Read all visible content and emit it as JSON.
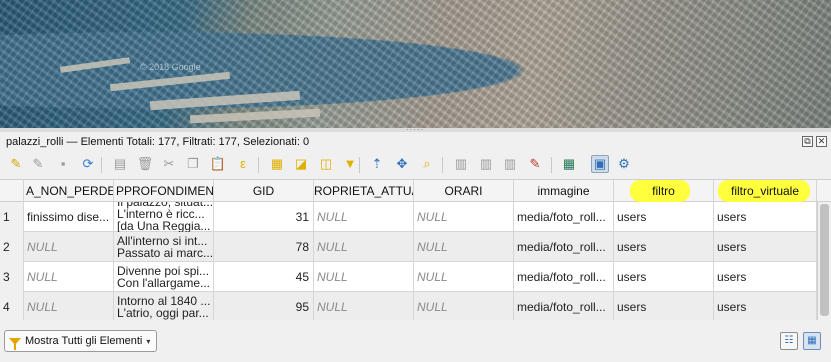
{
  "window": {
    "title": "palazzi_rolli — Elementi Totali: 177, Filtrati: 177, Selezionati: 0",
    "restore_glyph": "⧉",
    "close_glyph": "✕"
  },
  "map": {
    "watermark": "© 2018 Google"
  },
  "toolbar": {
    "buttons": [
      {
        "name": "toggle-editing-icon",
        "glyph": "✎",
        "color": "#d8a400"
      },
      {
        "name": "toggle-multi-edit-icon",
        "glyph": "✎",
        "color": "#9a9a9a"
      },
      {
        "name": "save-edits-icon",
        "glyph": "▪",
        "color": "#9a9a9a"
      },
      {
        "name": "reload-table-icon",
        "glyph": "⟳",
        "color": "#2d7fd0"
      },
      {
        "name": "add-feature-icon",
        "glyph": "▤",
        "color": "#9a9a9a"
      },
      {
        "name": "delete-features-icon",
        "glyph": "🗑",
        "color": "#9a9a9a"
      },
      {
        "name": "cut-features-icon",
        "glyph": "✂",
        "color": "#9a9a9a"
      },
      {
        "name": "copy-features-icon",
        "glyph": "❐",
        "color": "#9a9a9a"
      },
      {
        "name": "paste-features-icon",
        "glyph": "📋",
        "color": "#9a9a9a"
      },
      {
        "name": "select-by-expression-icon",
        "glyph": "ε",
        "color": "#e0b000"
      },
      {
        "name": "select-all-icon",
        "glyph": "▦",
        "color": "#e0b000"
      },
      {
        "name": "invert-selection-icon",
        "glyph": "◪",
        "color": "#e0b000"
      },
      {
        "name": "deselect-all-icon",
        "glyph": "◫",
        "color": "#e0b000"
      },
      {
        "name": "filter-select-icon",
        "glyph": "▼",
        "color": "#e0b000"
      },
      {
        "name": "move-selection-top-icon",
        "glyph": "⇡",
        "color": "#2d6fb8"
      },
      {
        "name": "pan-to-selection-icon",
        "glyph": "✥",
        "color": "#2d6fb8"
      },
      {
        "name": "zoom-to-selection-icon",
        "glyph": "⌕",
        "color": "#e0b000"
      },
      {
        "name": "new-field-icon",
        "glyph": "▥",
        "color": "#9a9a9a"
      },
      {
        "name": "delete-field-icon",
        "glyph": "▥",
        "color": "#9a9a9a"
      },
      {
        "name": "organize-columns-icon",
        "glyph": "▥",
        "color": "#9a9a9a"
      },
      {
        "name": "field-calculator-icon",
        "glyph": "✎",
        "color": "#c0392b"
      },
      {
        "name": "calculator-icon",
        "glyph": "▦",
        "color": "#2d6fb8"
      },
      {
        "name": "conditional-formatting-icon",
        "glyph": "▤",
        "color": "#3a8a3a"
      },
      {
        "name": "dock-table-icon",
        "glyph": "▣",
        "color": "#2d6fb8"
      },
      {
        "name": "actions-icon",
        "glyph": "⚙",
        "color": "#2d6fb8"
      }
    ]
  },
  "table": {
    "columns": [
      "A_NON_PERDERE",
      "PPROFONDIMENT",
      "GID",
      "ROPRIETA_ATTUAL",
      "ORARI",
      "immagine",
      "filtro",
      "filtro_virtuale"
    ],
    "rows": [
      {
        "num": "1",
        "a_non_perdere": "finissimo dise...",
        "approfondimento": [
          "Il palazzo, situat...",
          "L'interno è ricc...",
          "[da Una Reggia..."
        ],
        "gid": "31",
        "proprieta": "NULL",
        "orari": "NULL",
        "immagine": "media/foto_roll...",
        "filtro": "users",
        "filtro_virtuale": "users"
      },
      {
        "num": "2",
        "a_non_perdere": "NULL",
        "approfondimento": [
          "All'interno si int...",
          "Passato ai marc..."
        ],
        "gid": "78",
        "proprieta": "NULL",
        "orari": "NULL",
        "immagine": "media/foto_roll...",
        "filtro": "users",
        "filtro_virtuale": "users"
      },
      {
        "num": "3",
        "a_non_perdere": "NULL",
        "approfondimento": [
          "Divenne poi spi...",
          "Con l'allargame..."
        ],
        "gid": "45",
        "proprieta": "NULL",
        "orari": "NULL",
        "immagine": "media/foto_roll...",
        "filtro": "users",
        "filtro_virtuale": "users"
      },
      {
        "num": "4",
        "a_non_perdere": "NULL",
        "approfondimento": [
          "Intorno al 1840 ...",
          "L'atrio, oggi par..."
        ],
        "gid": "95",
        "proprieta": "NULL",
        "orari": "NULL",
        "immagine": "media/foto_roll...",
        "filtro": "users",
        "filtro_virtuale": "users"
      }
    ]
  },
  "highlight_color": "#ffff33",
  "bottom": {
    "filter_label": "Mostra Tutti gli Elementi",
    "caret": "▾",
    "form_view_glyph": "☷",
    "table_view_glyph": "▦"
  }
}
